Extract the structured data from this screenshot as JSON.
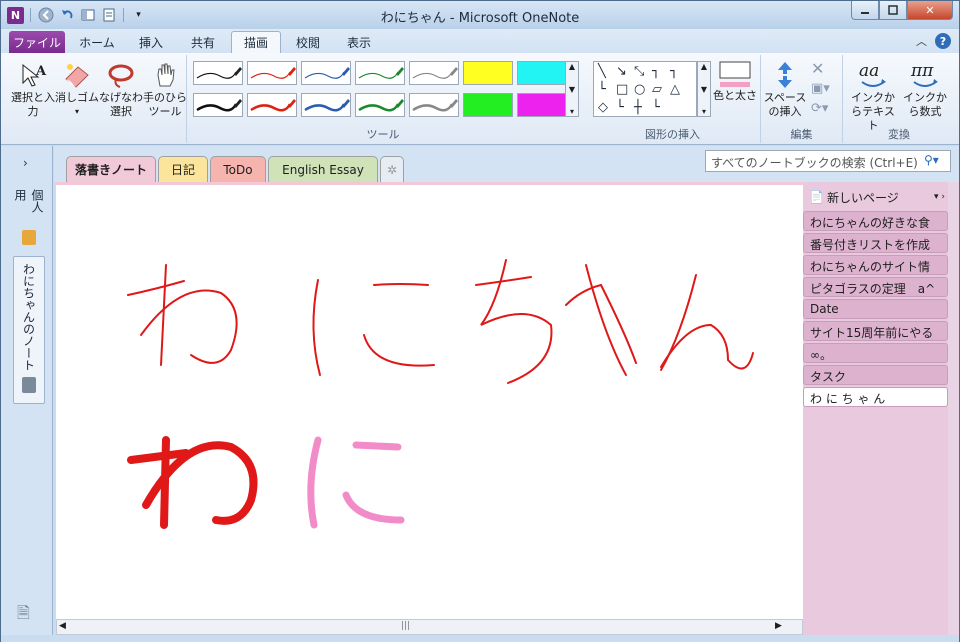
{
  "window": {
    "title": "わにちゃん - Microsoft OneNote"
  },
  "qat": {
    "app_logo": "N"
  },
  "ribbon_tabs": [
    {
      "label": "ファイル"
    },
    {
      "label": "ホーム"
    },
    {
      "label": "挿入"
    },
    {
      "label": "共有"
    },
    {
      "label": "描画"
    },
    {
      "label": "校閲"
    },
    {
      "label": "表示"
    }
  ],
  "ribbon": {
    "tools": {
      "select_label": "選択と入力",
      "eraser_label": "消しゴム",
      "lasso_label": "なげなわ選択",
      "pan_label": "手のひらツール",
      "group_label": "ツール"
    },
    "shapes": {
      "color_label": "色と太さ",
      "group_label": "図形の挿入"
    },
    "edit": {
      "insert_space_label": "スペースの挿入",
      "group_label": "編集"
    },
    "convert": {
      "ink_to_text_label": "インクからテキスト",
      "ink_to_math_label": "インクから数式",
      "group_label": "変換"
    }
  },
  "notebooks": [
    {
      "label": "個人用"
    },
    {
      "label": "わにちゃんのノート"
    }
  ],
  "sections": [
    {
      "label": "落書きノート"
    },
    {
      "label": "日記"
    },
    {
      "label": "ToDo"
    },
    {
      "label": "English Essay"
    }
  ],
  "search": {
    "placeholder": "すべてのノートブックの検索 (Ctrl+E)"
  },
  "pages": {
    "new_page_label": "新しいページ",
    "items": [
      {
        "label": "わにちゃんの好きな食"
      },
      {
        "label": "番号付きリストを作成"
      },
      {
        "label": "わにちゃんのサイト情"
      },
      {
        "label": "ピタゴラスの定理　a^"
      },
      {
        "label": "Date"
      },
      {
        "label": "サイト15周年前にやる"
      },
      {
        "label": "∞。"
      },
      {
        "label": "タスク"
      },
      {
        "label": "わ に ち ゃ ん"
      }
    ]
  },
  "colors": {
    "ink_red": "#e01818",
    "ink_pink": "#f28cc8",
    "file_tab": "#7a2b8e",
    "page_pane": "#e8c9de"
  }
}
